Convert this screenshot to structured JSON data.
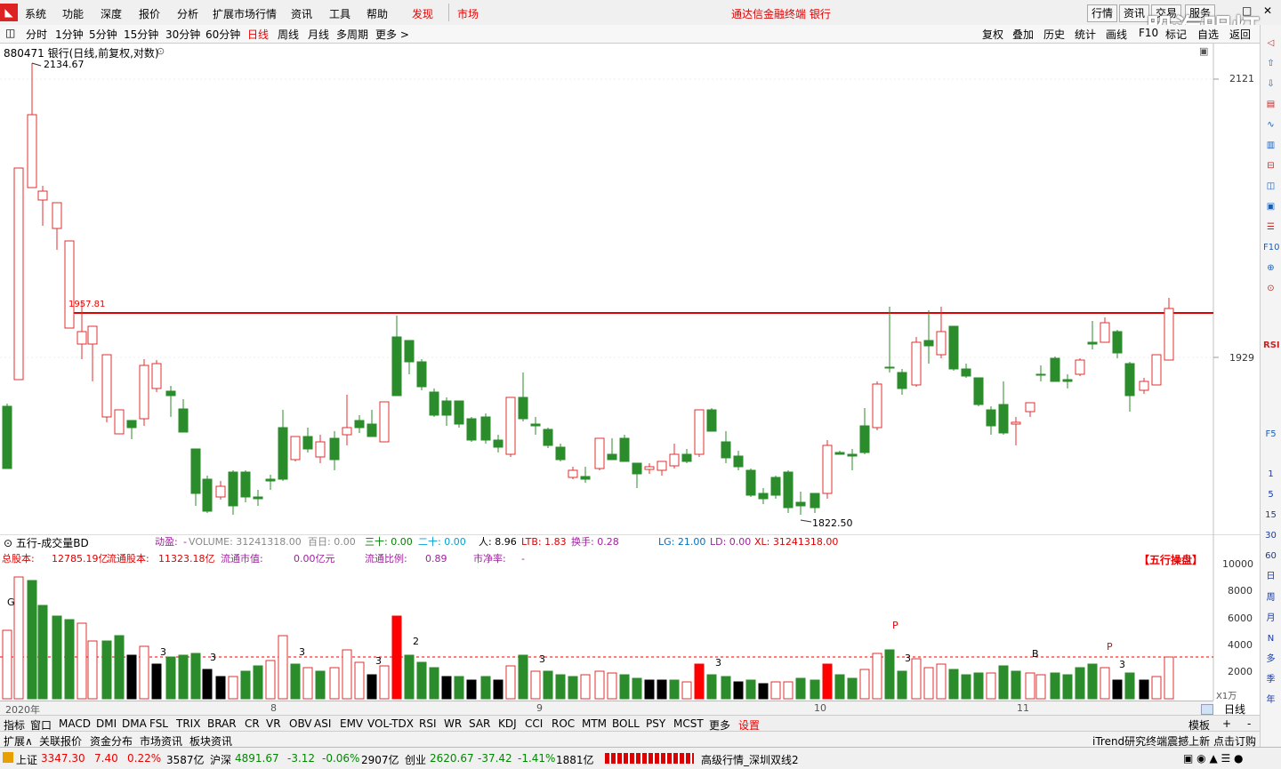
{
  "menubar": {
    "items": [
      "系统",
      "功能",
      "深度",
      "报价",
      "分析",
      "扩展市场行情",
      "资讯",
      "工具",
      "帮助"
    ],
    "discover": "发现",
    "market": "市场",
    "title": "通达信金融终端",
    "title_sub": "银行",
    "right_buttons": [
      "行情",
      "资讯",
      "交易",
      "服务"
    ],
    "watermark": "股海明灯"
  },
  "toolbar": {
    "periods": [
      "分时",
      "1分钟",
      "5分钟",
      "15分钟",
      "30分钟",
      "60分钟",
      "日线",
      "周线",
      "月线",
      "多周期",
      "更多 >"
    ],
    "active_period": "日线",
    "right_items": [
      "复权",
      "叠加",
      "历史",
      "统计",
      "画线",
      "F10",
      "标记",
      "自选",
      "返回"
    ]
  },
  "chart": {
    "header": "880471 银行(日线,前复权,对数)",
    "high_label": "2134.67",
    "low_label": "1822.50",
    "line_label": "1957.81",
    "y_labels": [
      "2121",
      "1929"
    ],
    "colors": {
      "up": "#e03030",
      "down": "#2a8c2a",
      "line": "#e00000"
    }
  },
  "volume": {
    "title": "五行-成交量BD",
    "row1": [
      {
        "t": "动盈:",
        "c": "#a020a0"
      },
      {
        "t": "-",
        "c": "#a020a0"
      },
      {
        "t": "VOLUME: 31241318.00",
        "c": "#888"
      },
      {
        "t": "百日: 0.00",
        "c": "#888"
      },
      {
        "t": "三十: 0.00",
        "c": "#008000"
      },
      {
        "t": "二十: 0.00",
        "c": "#00a0d0"
      },
      {
        "t": "人: 8.96",
        "c": "#000"
      },
      {
        "t": "LTB: 1.83",
        "c": "#d00"
      },
      {
        "t": "换手: 0.28",
        "c": "#a020a0"
      },
      {
        "t": "LG: 21.00",
        "c": "#0070c0"
      },
      {
        "t": "LD: 0.00",
        "c": "#a020a0"
      },
      {
        "t": "XL: 31241318.00",
        "c": "#d00"
      }
    ],
    "row2": [
      {
        "t": "总股本:",
        "c": "#d00"
      },
      {
        "t": "12785.19亿",
        "c": "#d00"
      },
      {
        "t": "流通股本:",
        "c": "#d00"
      },
      {
        "t": "11323.18亿",
        "c": "#d00"
      },
      {
        "t": "流通市值:",
        "c": "#a020a0"
      },
      {
        "t": "0.00亿元",
        "c": "#a020a0"
      },
      {
        "t": "流通比例:",
        "c": "#a020a0"
      },
      {
        "t": "0.89",
        "c": "#a020a0"
      },
      {
        "t": "市净率:",
        "c": "#a020a0"
      },
      {
        "t": "-",
        "c": "#a020a0"
      }
    ],
    "badge": "【五行操盘】",
    "y_labels": [
      "10000",
      "8000",
      "6000",
      "4000",
      "2000"
    ],
    "unit": "X1万",
    "markers": [
      "G",
      "3",
      "3",
      "3",
      "3",
      "2",
      "3",
      "3",
      "P",
      "3",
      "B",
      "P",
      "3"
    ]
  },
  "xaxis": {
    "labels": [
      "2020年",
      "8",
      "9",
      "10",
      "11"
    ],
    "right": "日线"
  },
  "indicator_tabs": [
    "指标",
    "窗口",
    "MACD",
    "DMI",
    "DMA",
    "FSL",
    "TRIX",
    "BRAR",
    "CR",
    "VR",
    "OBV",
    "ASI",
    "EMV",
    "VOL-TDX",
    "RSI",
    "WR",
    "SAR",
    "KDJ",
    "CCI",
    "ROC",
    "MTM",
    "BOLL",
    "PSY",
    "MCST",
    "更多",
    "设置"
  ],
  "indicator_right": [
    "模板",
    "+",
    "-"
  ],
  "infobar": {
    "tabs": [
      "扩展∧",
      "关联报价",
      "资金分布",
      "市场资讯",
      "板块资讯"
    ],
    "ticker": "iTrend研究终端震撼上新 点击订购"
  },
  "statusbar": {
    "sh_name": "上证",
    "sh_val": "3347.30",
    "sh_chg": "7.40",
    "sh_pct": "0.22%",
    "sh_amt": "3587亿",
    "hs_name": "沪深",
    "hs_val": "4891.67",
    "hs_chg": "-3.12",
    "hs_pct": "-0.06%",
    "hs_amt": "2907亿",
    "cy_name": "创业",
    "cy_val": "2620.67",
    "cy_chg": "-37.42",
    "cy_pct": "-1.41%",
    "cy_amt": "1881亿",
    "server": "高级行情_深圳双线2"
  },
  "rightbar": {
    "labels": [
      "RSI",
      "F5",
      "1",
      "5",
      "15",
      "30",
      "60",
      "日",
      "周",
      "月",
      "N",
      "多",
      "季",
      "年"
    ]
  }
}
